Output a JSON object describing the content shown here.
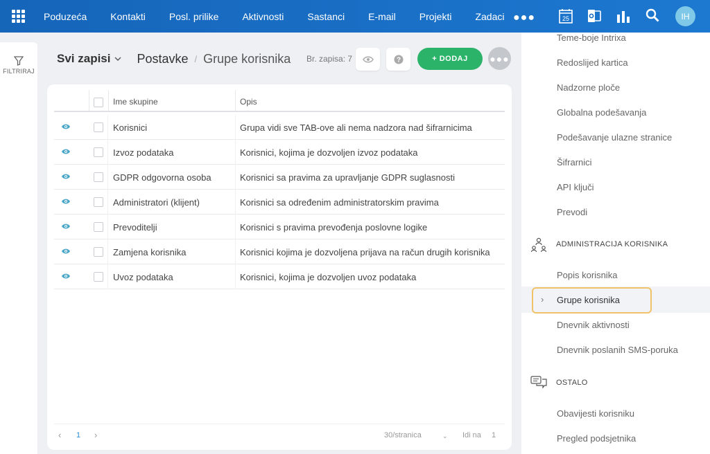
{
  "nav": {
    "items": [
      "Poduzeća",
      "Kontakti",
      "Posl. prilike",
      "Aktivnosti",
      "Sastanci",
      "E-mail",
      "Projekti",
      "Zadaci"
    ],
    "calendar_day": "25",
    "avatar_initials": "IH",
    "icons": [
      "apps-grid-icon",
      "more-dots-icon",
      "calendar-icon",
      "outlook-icon",
      "chart-icon",
      "search-icon"
    ]
  },
  "left": {
    "filter_label": "FILTRIRAJ"
  },
  "header": {
    "view_label": "Svi zapisi",
    "breadcrumb_root": "Postavke",
    "breadcrumb_sep": "/",
    "breadcrumb_current": "Grupe korisnika",
    "record_count_label": "Br. zapisa: 7",
    "add_button": "+ DODAJ"
  },
  "table": {
    "col_name": "Ime skupine",
    "col_desc": "Opis",
    "rows": [
      {
        "name": "Korisnici",
        "desc": "Grupa vidi sve TAB-ove ali nema nadzora nad šifrarnicima"
      },
      {
        "name": "Izvoz podataka",
        "desc": "Korisnici, kojima je dozvoljen izvoz podataka"
      },
      {
        "name": "GDPR odgovorna osoba",
        "desc": "Korisnici sa pravima za upravljanje GDPR suglasnosti"
      },
      {
        "name": "Administratori (klijent)",
        "desc": "Korisnici sa određenim administratorskim pravima"
      },
      {
        "name": "Prevoditelji",
        "desc": "Korisnici s pravima prevođenja poslovne logike"
      },
      {
        "name": "Zamjena korisnika",
        "desc": "Korisnici kojima je dozvoljena prijava na račun drugih korisnika"
      },
      {
        "name": "Uvoz podataka",
        "desc": "Korisnici, kojima je dozvoljen uvoz podataka"
      }
    ]
  },
  "pager": {
    "page": "1",
    "per_page": "30/stranica",
    "goto_label": "Idi na",
    "goto_value": "1"
  },
  "settings": {
    "items_top": [
      "Teme-boje Intrixa",
      "Redoslijed kartica",
      "Nadzorne ploče",
      "Globalna podešavanja",
      "Podešavanje ulazne stranice",
      "Šifrarnici",
      "API ključi",
      "Prevodi"
    ],
    "section_admin": "ADMINISTRACIJA KORISNIKA",
    "items_admin": [
      "Popis korisnika",
      "Grupe korisnika",
      "Dnevnik aktivnosti",
      "Dnevnik poslanih SMS-poruka"
    ],
    "section_other": "OSTALO",
    "items_other": [
      "Obavijesti korisniku",
      "Pregled podsjetnika"
    ]
  },
  "colors": {
    "nav": "#1a6fc4",
    "accent_green": "#2cb36a",
    "eye_teal": "#4aa6c9",
    "highlight": "#f0c36b"
  }
}
